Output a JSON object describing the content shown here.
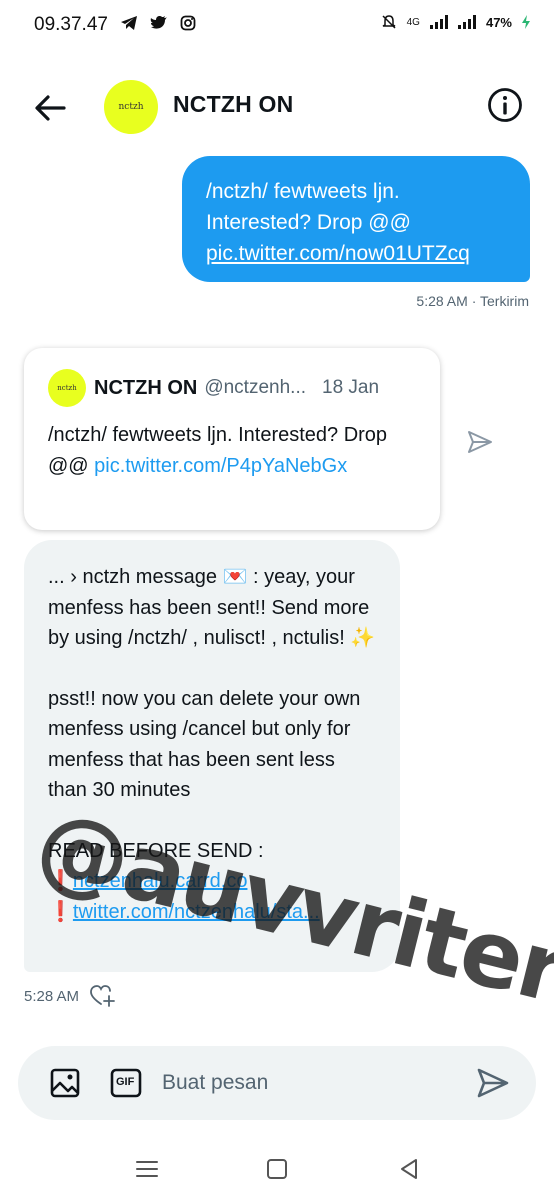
{
  "status_bar": {
    "time": "09.37.47",
    "network": "4G",
    "battery": "47%"
  },
  "header": {
    "avatar_text": "nctzh",
    "title": "NCTZH ON"
  },
  "sent_message": {
    "line1": "/nctzh/ fewtweets ljn.",
    "line2": "Interested? Drop @@",
    "link": "pic.twitter.com/now01UTZcq",
    "time": "5:28 AM",
    "status": "Terkirim"
  },
  "quoted_tweet": {
    "avatar_text": "nctzh",
    "name": "NCTZH ON",
    "handle": "@nctzenh...",
    "date": "18 Jan",
    "text": "/nctzh/ fewtweets ljn. Interested? Drop @@ ",
    "link": "pic.twitter.com/P4pYaNebGx"
  },
  "received_message": {
    "para1": "... › nctzh message 💌 : yeay, your menfess has been sent!! Send more by using /nctzh/ , nulisct! , nctulis! ✨",
    "para2": "psst!! now you can delete your own menfess using /cancel but only for menfess that has been sent less than 30 minutes",
    "para3": "READ BEFORE SEND :",
    "link1": "nctzenhalu.carrd.co",
    "link2": "twitter.com/nctzenhalu/sta...",
    "bullet": "❗",
    "time": "5:28 AM"
  },
  "watermark": "@auvvriter",
  "composer": {
    "placeholder": "Buat pesan",
    "gif_label": "GIF"
  },
  "colors": {
    "accent": "#1d9bf0",
    "avatar_bg": "#e8ff1f",
    "bubble_bg": "#eff3f4"
  }
}
